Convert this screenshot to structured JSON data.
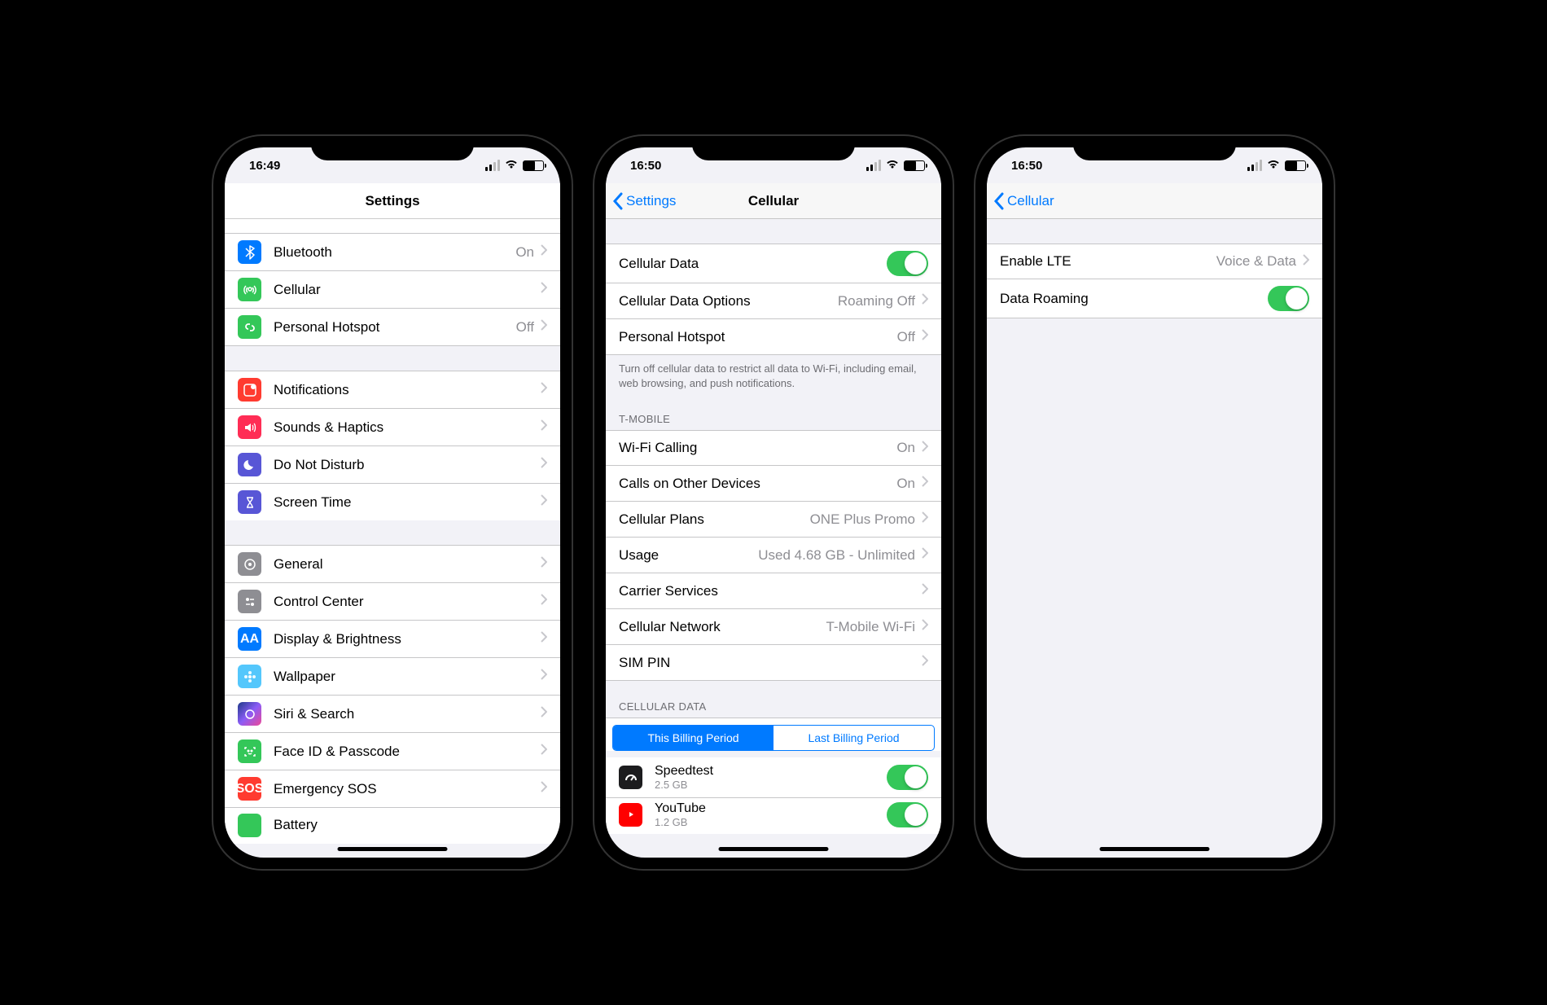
{
  "status": {
    "time1": "16:49",
    "time2": "16:50",
    "time3": "16:50"
  },
  "screen1": {
    "title": "Settings",
    "rows": {
      "bluetooth": {
        "label": "Bluetooth",
        "value": "On"
      },
      "cellular": {
        "label": "Cellular"
      },
      "hotspot": {
        "label": "Personal Hotspot",
        "value": "Off"
      },
      "notifications": {
        "label": "Notifications"
      },
      "sounds": {
        "label": "Sounds & Haptics"
      },
      "dnd": {
        "label": "Do Not Disturb"
      },
      "screentime": {
        "label": "Screen Time"
      },
      "general": {
        "label": "General"
      },
      "controlcenter": {
        "label": "Control Center"
      },
      "display": {
        "label": "Display & Brightness"
      },
      "wallpaper": {
        "label": "Wallpaper"
      },
      "siri": {
        "label": "Siri & Search"
      },
      "faceid": {
        "label": "Face ID & Passcode"
      },
      "sos": {
        "label": "Emergency SOS"
      },
      "battery": {
        "label": "Battery"
      }
    }
  },
  "screen2": {
    "back": "Settings",
    "title": "Cellular",
    "rows": {
      "cellulardata": {
        "label": "Cellular Data",
        "on": true
      },
      "cdo": {
        "label": "Cellular Data Options",
        "value": "Roaming Off"
      },
      "hotspot": {
        "label": "Personal Hotspot",
        "value": "Off"
      },
      "wificalling": {
        "label": "Wi-Fi Calling",
        "value": "On"
      },
      "callsother": {
        "label": "Calls on Other Devices",
        "value": "On"
      },
      "plans": {
        "label": "Cellular Plans",
        "value": "ONE Plus Promo"
      },
      "usage": {
        "label": "Usage",
        "value": "Used 4.68 GB - Unlimited"
      },
      "carrier": {
        "label": "Carrier Services"
      },
      "network": {
        "label": "Cellular Network",
        "value": "T-Mobile Wi-Fi"
      },
      "simpin": {
        "label": "SIM PIN"
      }
    },
    "footer1": "Turn off cellular data to restrict all data to Wi-Fi, including email, web browsing, and push notifications.",
    "header1": "T-MOBILE",
    "header2": "CELLULAR DATA",
    "segments": {
      "a": "This Billing Period",
      "b": "Last Billing Period"
    },
    "apps": {
      "speedtest": {
        "label": "Speedtest",
        "sub": "2.5 GB",
        "on": true
      },
      "youtube": {
        "label": "YouTube",
        "sub": "1.2 GB",
        "on": true
      }
    }
  },
  "screen3": {
    "back": "Cellular",
    "rows": {
      "lte": {
        "label": "Enable LTE",
        "value": "Voice & Data"
      },
      "roaming": {
        "label": "Data Roaming",
        "on": true
      }
    }
  }
}
